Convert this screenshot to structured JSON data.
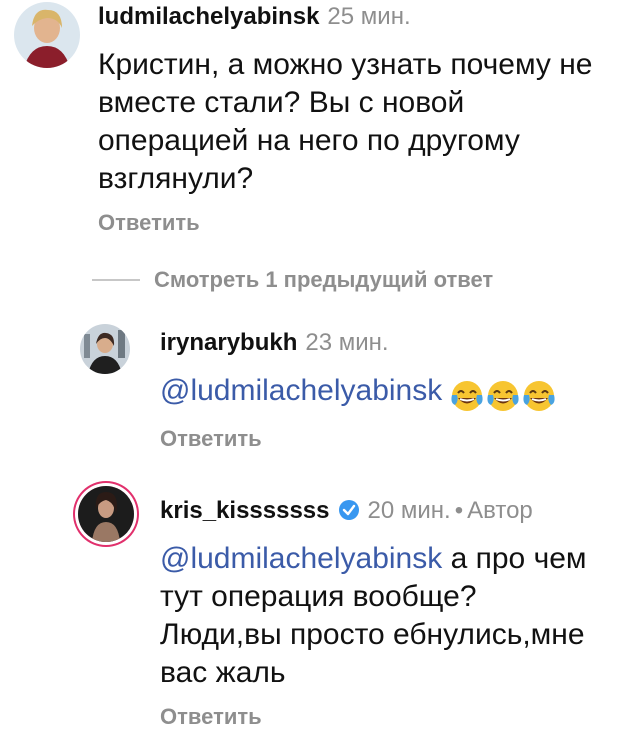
{
  "comments": [
    {
      "username": "ludmilachelyabinsk",
      "time": "25 мин.",
      "text": "Кристин, а можно узнать почему не вместе стали? Вы с новой операцией на него по другому взглянули?",
      "reply_label": "Ответить"
    },
    {
      "username": "irynarybukh",
      "time": "23 мин.",
      "mention": "@ludmilachelyabinsk",
      "emojis": [
        "face-with-tears-of-joy-icon",
        "face-with-tears-of-joy-icon",
        "face-with-tears-of-joy-icon"
      ],
      "reply_label": "Ответить"
    },
    {
      "username": "kris_kisssssss",
      "time": "20 мин.",
      "separator": "•",
      "author_label": "Автор",
      "mention": "@ludmilachelyabinsk",
      "text": "а про чем тут операция вообще? Люди,вы просто ебнулись,мне вас жаль",
      "reply_label": "Ответить"
    }
  ],
  "view_previous": "Смотреть 1 предыдущий ответ",
  "colors": {
    "mention": "#3b5ba8",
    "secondary": "#8e8e8e",
    "verified": "#3897f0"
  }
}
